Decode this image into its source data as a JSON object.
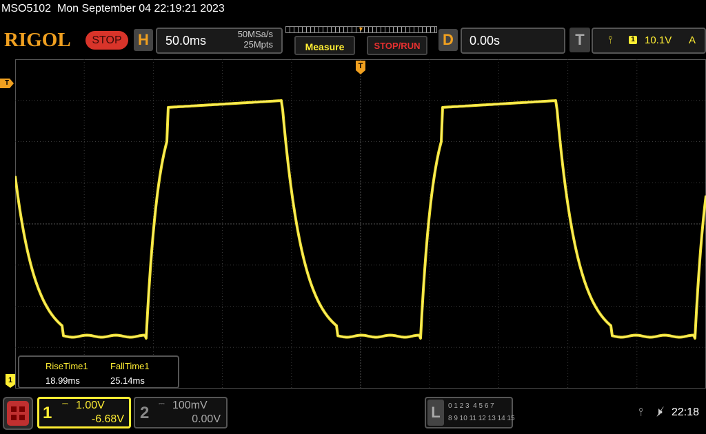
{
  "header": {
    "model": "MSO5102",
    "datetime": "Mon September 04 22:19:21 2023"
  },
  "topbar": {
    "brand": "RIGOL",
    "run_state": "STOP",
    "horizontal_tag": "H",
    "timebase": "50.0ms",
    "sample_rate": "50MSa/s",
    "memory_depth": "25Mpts",
    "measure_label": "Measure",
    "stoprun_label": "STOP/RUN",
    "delay_tag": "D",
    "delay": "0.00s",
    "trigger_tag": "T",
    "trigger_source": "1",
    "trigger_level": "10.1V",
    "trigger_mode": "A"
  },
  "markers": {
    "trigger_level": "T",
    "trigger_position": "T",
    "ch1_offset": "1"
  },
  "measurements": [
    {
      "label": "RiseTime1",
      "value": "18.99ms"
    },
    {
      "label": "FallTime1",
      "value": "25.14ms"
    }
  ],
  "channels": {
    "ch1": {
      "number": "1",
      "scale": "1.00V",
      "offset": "-6.68V",
      "coupling_symbol": "⎓",
      "color": "#ffee33"
    },
    "ch2": {
      "number": "2",
      "scale": "100mV",
      "offset": "0.00V",
      "coupling_symbol": "⎓",
      "color": "#888888"
    }
  },
  "logic": {
    "tag": "L",
    "row1": "0 1 2 3  4 5 6 7",
    "row2": "8 9 10 11 12 13 14 15"
  },
  "statusbar": {
    "usb_icon": "usb-icon",
    "sound_icon": "speaker-muted-icon",
    "time": "22:18"
  },
  "colors": {
    "accent": "#f0a020",
    "trace": "#ffee33",
    "stop": "#d8342a"
  }
}
